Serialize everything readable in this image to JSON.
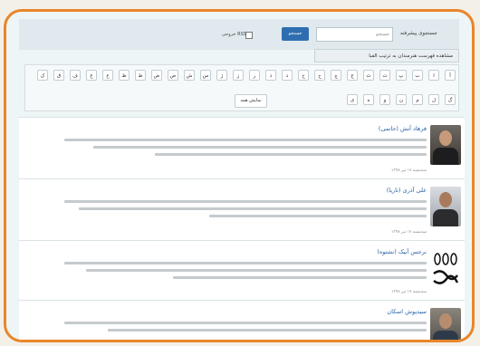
{
  "search": {
    "label": "جستجوی پیشرفته",
    "placeholder": "جستجو",
    "button": "جستجو",
    "rss_label": "خروجی RSS"
  },
  "tooltip": "مشاهده فهرست هنرمندان به ترتیب الفبا",
  "letters": {
    "row1": [
      "آ",
      "ا",
      "ب",
      "پ",
      "ت",
      "ث",
      "ج",
      "چ",
      "ح",
      "خ",
      "د",
      "ذ",
      "ر",
      "ز",
      "ژ",
      "س",
      "ش",
      "ص",
      "ض",
      "ط",
      "ظ",
      "ع",
      "غ",
      "ف",
      "ق",
      "ک"
    ],
    "row2": [
      "گ",
      "ل",
      "م",
      "ن",
      "و",
      "ه",
      "ی"
    ],
    "show_all": "نمایش همه"
  },
  "entries": [
    {
      "title": "فرهاد آتش (حاتمی)",
      "date": "سه‌شنبه ۱۷ تیر ۱۳۹۸"
    },
    {
      "title": "علی آذری (تاریا)",
      "date": "سه‌شنبه ۱۷ تیر ۱۳۹۸"
    },
    {
      "title": "نرجس آبیک (نشتوه)",
      "date": "سه‌شنبه ۱۷ تیر ۱۳۹۸"
    },
    {
      "title": "سیدپوش اسکان",
      "date": ""
    }
  ],
  "colors": {
    "frame": "#e8862b",
    "link": "#2a63a8",
    "button": "#2f6fb0"
  }
}
